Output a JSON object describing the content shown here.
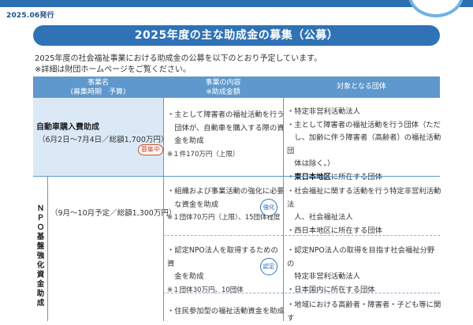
{
  "header": {
    "issue_date": "2025.06発行"
  },
  "title": "2025年度の主な助成金の募集（公募）",
  "intro": {
    "line1": "2025年度の社会福祉事業における助成金の公募を以下のとおり予定しています。",
    "line2": "※詳細は財団ホームページをご覧ください。"
  },
  "table": {
    "headers": {
      "program_l1": "事業名",
      "program_l2": "(募集時期　予算)",
      "content_l1": "事業の内容",
      "content_l2": "※助成金額",
      "target": "対象となる団体"
    },
    "rows": [
      {
        "program": "自動車購入費助成",
        "period": "（6月2日〜7月4日／総額1,700万円）",
        "badge": "募集中",
        "content": [
          "・主として障害者の福祉活動を行う",
          "　団体が、自動車を購入する際の資",
          "　金を助成"
        ],
        "amount": "※１件170万円（上限）",
        "targets": [
          "・特定非営利活動法人",
          "・主として障害者の福祉活動を行う団体（ただ",
          "　し、加齢に伴う障害者（高齢者）の福祉活動団",
          "　体は除く。）"
        ],
        "region_bold": "・東日本地区",
        "region_rest": "に所在する団体"
      }
    ],
    "npo": {
      "vertical_label": "ＮＰＯ基盤強化資金助成",
      "period": "（9月〜10月予定／総額1,300万円）",
      "subs": [
        {
          "content": [
            "・組織および事業活動の強化に必要",
            "　な資金を助成"
          ],
          "badge": "強化",
          "amount": "※１団体70万円（上限）、15団体程度",
          "targets": [
            "・社会福祉に関する活動を行う特定非営利活動法",
            "　人、社会福祉法人",
            "・西日本地区に所在する団体"
          ]
        },
        {
          "content": [
            "・認定NPO法人を取得するための資",
            "　金を助成"
          ],
          "badge": "認定",
          "amount": "※１団体30万円、10団体",
          "targets": [
            "・認定NPO法人の取得を目指す社会福祉分野の",
            "　特定非営利活動法人",
            "・日本国内に所在する団体"
          ]
        },
        {
          "content": [
            "・住民参加型の福祉活動資金を助成"
          ],
          "targets": [
            "・地域における高齢者・障害者・子ども等に関す"
          ]
        }
      ]
    }
  },
  "colors": {
    "brand": "#2f72b5",
    "header_fill": "#5f98cc",
    "highlight_cell": "#dbe9f6",
    "badge_active": "#c9482a"
  }
}
